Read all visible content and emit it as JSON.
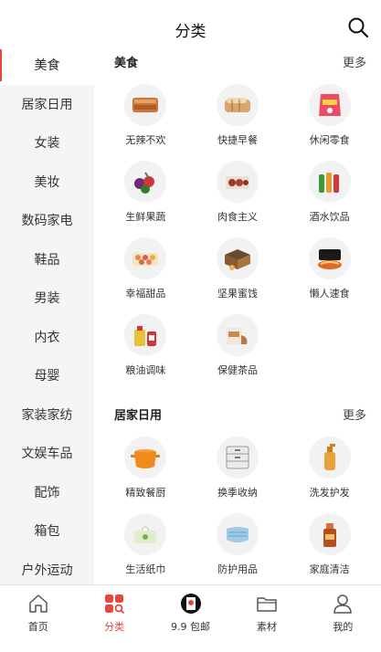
{
  "header": {
    "title": "分类",
    "search_icon": "search-icon"
  },
  "sidebar": {
    "items": [
      {
        "label": "美食",
        "active": true
      },
      {
        "label": "居家日用"
      },
      {
        "label": "女装"
      },
      {
        "label": "美妆"
      },
      {
        "label": "数码家电"
      },
      {
        "label": "鞋品"
      },
      {
        "label": "男装"
      },
      {
        "label": "内衣"
      },
      {
        "label": "母婴"
      },
      {
        "label": "家装家纺"
      },
      {
        "label": "文娱车品"
      },
      {
        "label": "配饰"
      },
      {
        "label": "箱包"
      },
      {
        "label": "户外运动"
      }
    ]
  },
  "sections": [
    {
      "title": "美食",
      "more": "更多",
      "items": [
        {
          "label": "无辣不欢",
          "icon": "spicy-food-icon"
        },
        {
          "label": "快捷早餐",
          "icon": "bread-icon"
        },
        {
          "label": "休闲零食",
          "icon": "snack-bag-icon"
        },
        {
          "label": "生鲜果蔬",
          "icon": "fruit-icon"
        },
        {
          "label": "肉食主义",
          "icon": "meat-icon"
        },
        {
          "label": "酒水饮品",
          "icon": "drinks-icon"
        },
        {
          "label": "幸福甜品",
          "icon": "dessert-icon"
        },
        {
          "label": "坚果蜜饯",
          "icon": "nuts-icon"
        },
        {
          "label": "懒人速食",
          "icon": "instant-noodle-icon"
        },
        {
          "label": "粮油调味",
          "icon": "oil-icon"
        },
        {
          "label": "保健茶品",
          "icon": "tea-icon"
        }
      ]
    },
    {
      "title": "居家日用",
      "more": "更多",
      "items": [
        {
          "label": "精致餐厨",
          "icon": "pot-icon"
        },
        {
          "label": "换季收纳",
          "icon": "storage-box-icon"
        },
        {
          "label": "洗发护发",
          "icon": "shampoo-icon"
        },
        {
          "label": "生活纸巾",
          "icon": "tissue-icon"
        },
        {
          "label": "防护用品",
          "icon": "mask-icon"
        },
        {
          "label": "家庭清洁",
          "icon": "cleaner-icon"
        }
      ]
    }
  ],
  "tabbar": [
    {
      "label": "首页",
      "icon": "home-icon"
    },
    {
      "label": "分类",
      "icon": "category-icon",
      "active": true
    },
    {
      "label": "9.9 包邮",
      "icon": "coin-icon"
    },
    {
      "label": "素材",
      "icon": "folder-icon"
    },
    {
      "label": "我的",
      "icon": "user-icon"
    }
  ],
  "colors": {
    "accent": "#e8453c",
    "sidebar_bg": "#f5f5f5"
  }
}
